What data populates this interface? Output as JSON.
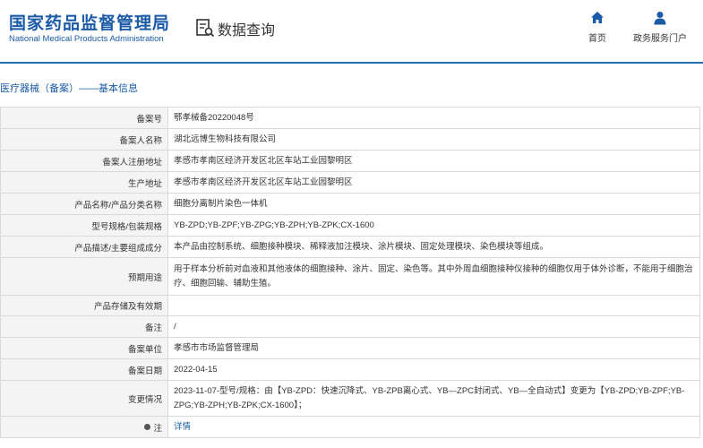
{
  "header": {
    "title_cn": "国家药品监督管理局",
    "title_en": "National Medical Products Administration",
    "data_query": "数据查询",
    "nav_home": "首页",
    "nav_portal": "政务服务门户"
  },
  "section_title": "医疗器械（备案）——基本信息",
  "rows": [
    {
      "label": "备案号",
      "value": "鄂孝械备20220048号"
    },
    {
      "label": "备案人名称",
      "value": "湖北远博生物科技有限公司"
    },
    {
      "label": "备案人注册地址",
      "value": "孝感市孝南区经济开发区北区车站工业园黎明区"
    },
    {
      "label": "生产地址",
      "value": "孝感市孝南区经济开发区北区车站工业园黎明区"
    },
    {
      "label": "产品名称/产品分类名称",
      "value": "细胞分离制片染色一体机"
    },
    {
      "label": "型号规格/包装规格",
      "value": "YB-ZPD;YB-ZPF;YB-ZPG;YB-ZPH;YB-ZPK;CX-1600"
    },
    {
      "label": "产品描述/主要组成成分",
      "value": "本产品由控制系统、细胞接种模块、稀释液加注模块、涂片模块、固定处理模块、染色模块等组成。"
    },
    {
      "label": "预期用途",
      "value": "用于样本分析前对血液和其他液体的细胞接种、涂片、固定、染色等。其中外周血细胞接种仪接种的细胞仅用于体外诊断，不能用于细胞治疗、细胞回输、辅助生殖。"
    },
    {
      "label": "产品存储及有效期",
      "value": ""
    },
    {
      "label": "备注",
      "value": "/"
    },
    {
      "label": "备案单位",
      "value": "孝感市市场监督管理局"
    },
    {
      "label": "备案日期",
      "value": "2022-04-15"
    },
    {
      "label": "变更情况",
      "value": "2023-11-07-型号/规格：由【YB-ZPD：快速沉降式、YB-ZPB离心式、YB—ZPC封闭式、YB—全自动式】变更为【YB-ZPD;YB-ZPF;YB-ZPG;YB-ZPH;YB-ZPK;CX-1600】；"
    }
  ],
  "note": {
    "label": "注",
    "value": "详情"
  },
  "colors": {
    "brand": "#1a5aa6",
    "label_bg": "#f4f4f4",
    "border": "#d9d9d9"
  }
}
